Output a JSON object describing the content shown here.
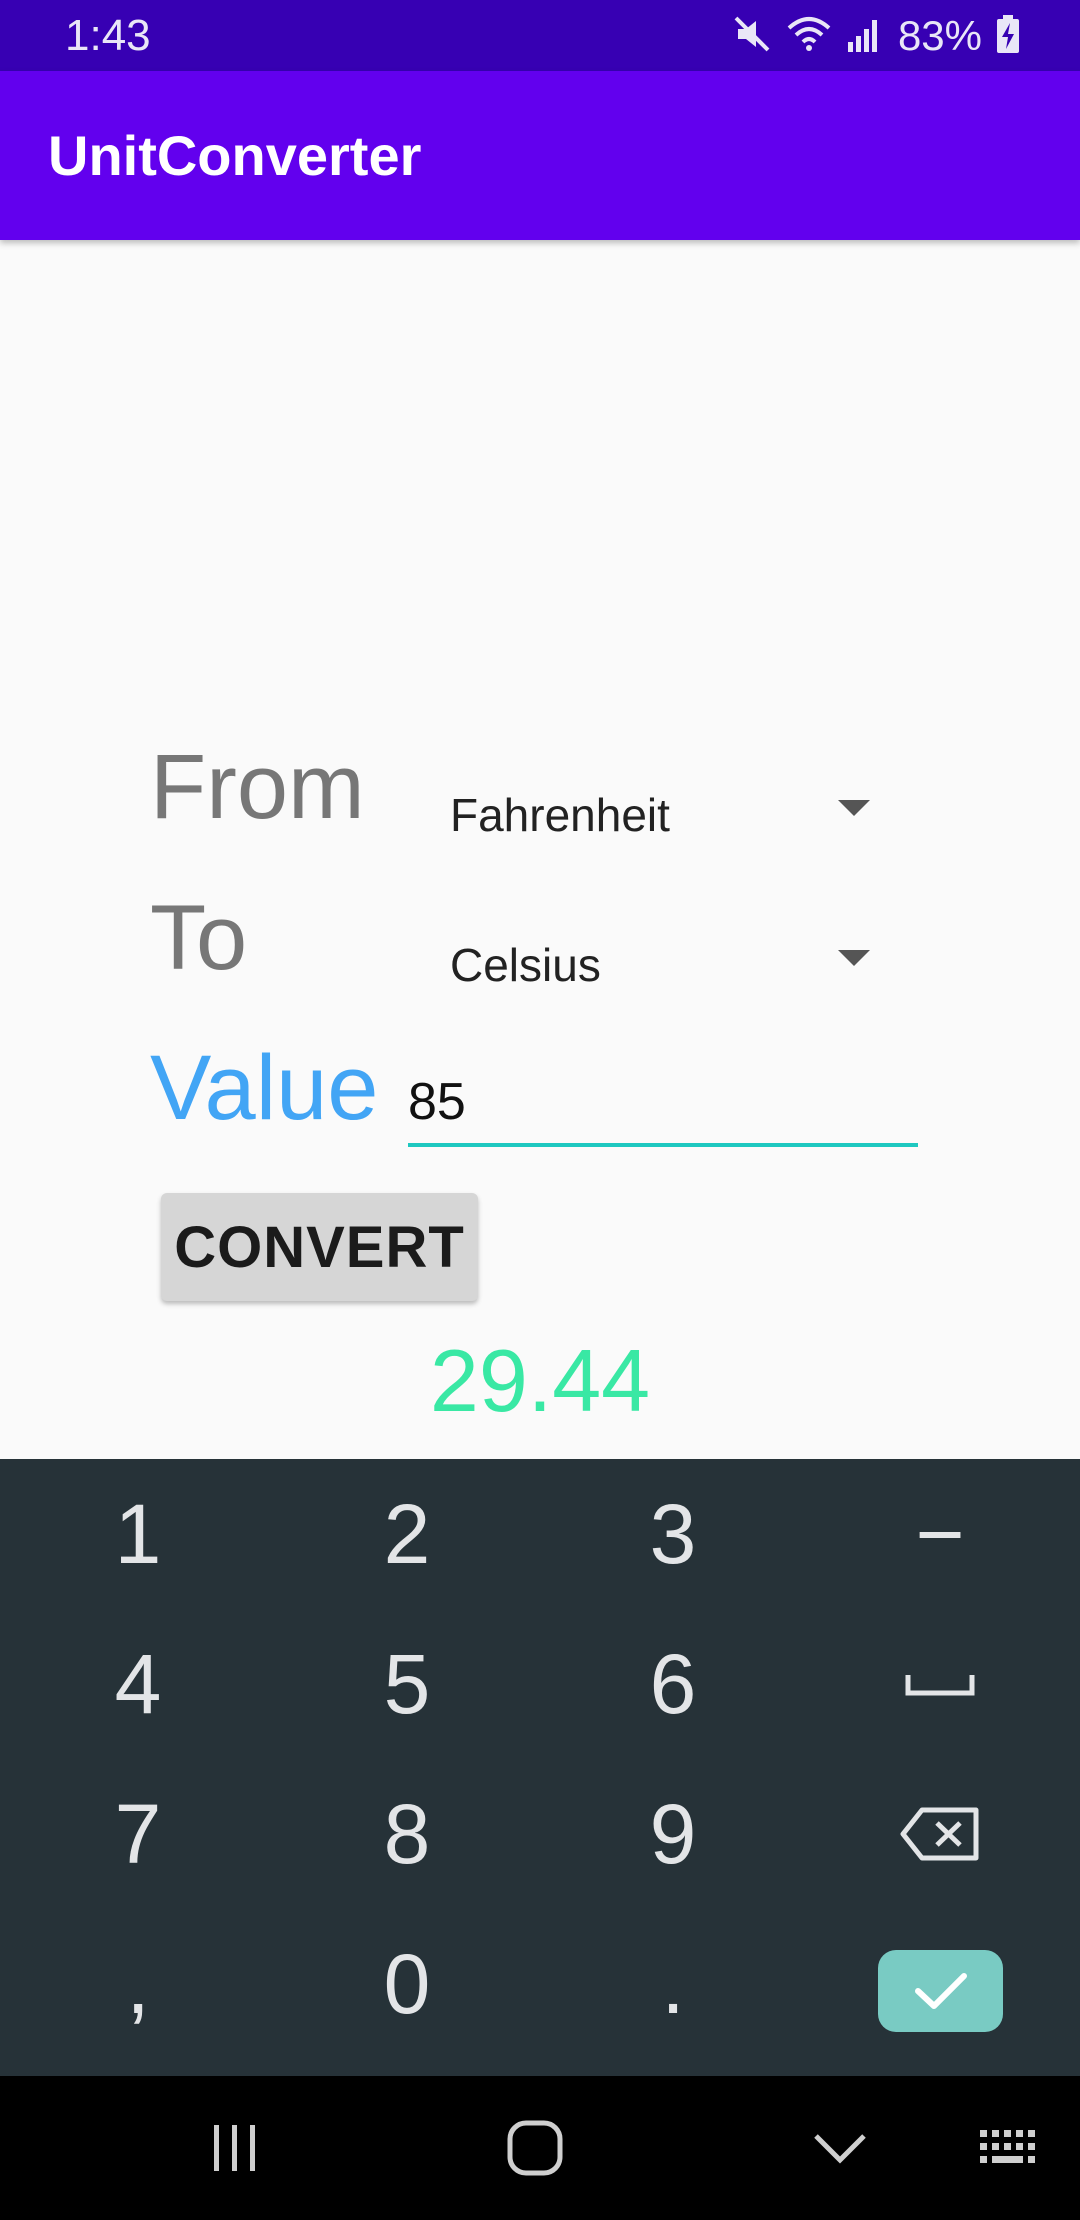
{
  "status_bar": {
    "time": "1:43",
    "battery_percent": "83%",
    "icons": [
      "mute-icon",
      "wifi-icon",
      "signal-icon",
      "battery-charging-icon"
    ]
  },
  "app_bar": {
    "title": "UnitConverter"
  },
  "form": {
    "from_label": "From",
    "to_label": "To",
    "value_label": "Value",
    "from_selected": "Fahrenheit",
    "to_selected": "Celsius",
    "value_input": "85",
    "convert_label": "CONVERT",
    "result": "29.44"
  },
  "keyboard": {
    "rows": [
      [
        "1",
        "2",
        "3",
        "−"
      ],
      [
        "4",
        "5",
        "6",
        "space"
      ],
      [
        "7",
        "8",
        "9",
        "backspace"
      ],
      [
        ",",
        "0",
        ".",
        "done"
      ]
    ],
    "key_labels": {
      "k1": "1",
      "k2": "2",
      "k3": "3",
      "kminus": "−",
      "k4": "4",
      "k5": "5",
      "k6": "6",
      "k7": "7",
      "k8": "8",
      "k9": "9",
      "kcomma": ",",
      "k0": "0",
      "kdot": "."
    }
  },
  "nav_bar": {
    "icons": [
      "recents-icon",
      "home-icon",
      "back-chevron-icon",
      "keyboard-icon"
    ]
  },
  "colors": {
    "status_bar": "#3700b3",
    "app_bar": "#6200ee",
    "value_label": "#42a5f5",
    "result": "#39e8a4",
    "keyboard_bg": "#263238",
    "ok_key": "#79cbc3"
  }
}
